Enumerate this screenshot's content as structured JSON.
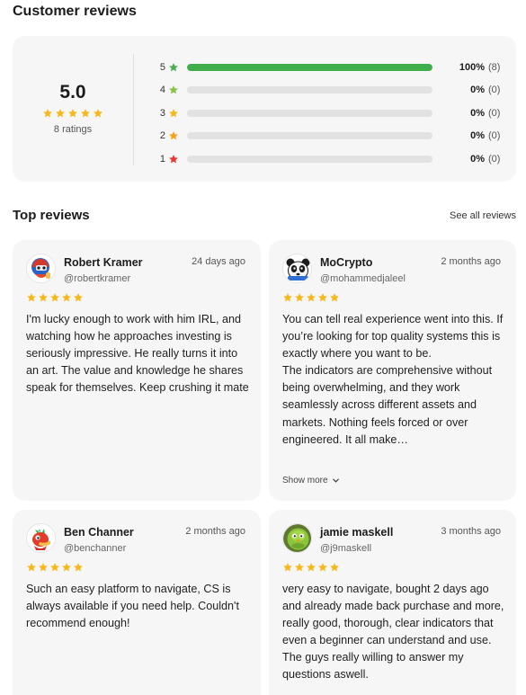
{
  "page": {
    "title": "Customer reviews",
    "top_reviews_title": "Top reviews",
    "see_all_label": "See all reviews"
  },
  "colors": {
    "star_gold": "#f5b91e",
    "bar_green": "#41ae4c",
    "star_green": "#4caf50",
    "star_lightgreen": "#8bc34a",
    "star_orange": "#f5a21b",
    "star_red": "#e53935"
  },
  "summary": {
    "average": "5.0",
    "stars": 5,
    "ratings_label": "8 ratings",
    "rows": [
      {
        "stars": "5",
        "percent": "100%",
        "count": "(8)",
        "fill": 1.0,
        "star_color": "#4caf50"
      },
      {
        "stars": "4",
        "percent": "0%",
        "count": "(0)",
        "fill": 0.0,
        "star_color": "#8bc34a"
      },
      {
        "stars": "3",
        "percent": "0%",
        "count": "(0)",
        "fill": 0.0,
        "star_color": "#f5b91e"
      },
      {
        "stars": "2",
        "percent": "0%",
        "count": "(0)",
        "fill": 0.0,
        "star_color": "#f5a21b"
      },
      {
        "stars": "1",
        "percent": "0%",
        "count": "(0)",
        "fill": 0.0,
        "star_color": "#e53935"
      }
    ]
  },
  "reviews": [
    {
      "name": "Robert Kramer",
      "handle": "@robertkramer",
      "date": "24 days ago",
      "rating": 5,
      "avatar_icon": "robot-mascot-red-icon",
      "paragraphs": [
        "I'm lucky enough to work with him IRL, and watching how he approaches investing is seriously impressive. He really turns it into an art. The value and knowledge he shares speak for themselves. Keep crushing it mate"
      ]
    },
    {
      "name": "MoCrypto",
      "handle": "@mohammedjaleel",
      "date": "2 months ago",
      "rating": 5,
      "avatar_icon": "panda-mascot-icon",
      "paragraphs": [
        "You can tell real experience went into this. If you’re looking for top quality systems this is exactly where you want to be.",
        "The indicators are comprehensive without being overwhelming, and they work seamlessly across different assets and markets. Nothing feels forced or over engineered. It all make…"
      ],
      "show_more": "Show more"
    },
    {
      "name": "Ben Channer",
      "handle": "@benchanner",
      "date": "2 months ago",
      "rating": 5,
      "avatar_icon": "red-creature-mascot-icon",
      "paragraphs": [
        "Such an easy platform to navigate, CS is always available if you need help. Couldn't recommend enough!"
      ]
    },
    {
      "name": "jamie maskell",
      "handle": "@j9maskell",
      "date": "3 months ago",
      "rating": 5,
      "avatar_icon": "green-bird-mascot-icon",
      "paragraphs": [
        "very easy to navigate, bought 2 days ago and already made back purchase and more, really good, thorough, clear indicators that even a beginner can understand and use. The guys really willing to answer my questions aswell."
      ]
    }
  ]
}
